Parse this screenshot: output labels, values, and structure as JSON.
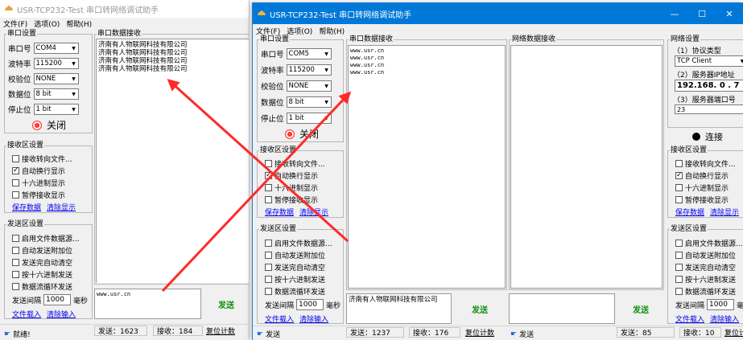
{
  "windows": [
    {
      "title": "USR-TCP232-Test 串口转网络调试助手",
      "menu": [
        "文件(F)",
        "选项(O)",
        "帮助(H)"
      ],
      "serial_settings": {
        "title": "串口设置",
        "port_label": "串口号",
        "port_value": "COM4",
        "baud_label": "波特率",
        "baud_value": "115200",
        "parity_label": "校验位",
        "parity_value": "NONE",
        "data_label": "数据位",
        "data_value": "8 bit",
        "stop_label": "停止位",
        "stop_value": "1 bit",
        "close_label": "关闭"
      },
      "recv_settings": {
        "title": "接收区设置",
        "items": [
          {
            "label": "接收转向文件...",
            "checked": false
          },
          {
            "label": "自动换行显示",
            "checked": true
          },
          {
            "label": "十六进制显示",
            "checked": false
          },
          {
            "label": "暂停接收显示",
            "checked": false
          }
        ],
        "save_label": "保存数据",
        "clear_label": "清除显示"
      },
      "send_settings": {
        "title": "发送区设置",
        "items": [
          {
            "label": "启用文件数据源...",
            "checked": false
          },
          {
            "label": "自动发送附加位",
            "checked": false
          },
          {
            "label": "发送完自动清空",
            "checked": false
          },
          {
            "label": "按十六进制发送",
            "checked": false
          },
          {
            "label": "数据流循环发送",
            "checked": false
          }
        ],
        "interval_label": "发送间隔",
        "interval_value": "1000",
        "interval_unit": "毫秒",
        "load_label": "文件载入",
        "clear_label": "清除输入"
      },
      "recv_panel": {
        "title": "串口数据接收",
        "content": "济南有人物联网科技有限公司\n济南有人物联网科技有限公司\n济南有人物联网科技有限公司\n济南有人物联网科技有限公司"
      },
      "send_input": "www.usr.cn",
      "send_button": "发送",
      "status": {
        "state": "就绪!",
        "sent": "发送：1623",
        "recv": "接收：184",
        "reset": "复位计数"
      }
    },
    {
      "title": "USR-TCP232-Test 串口转网络调试助手",
      "menu": [
        "文件(F)",
        "选项(O)",
        "帮助(H)"
      ],
      "caption": {
        "minimize": "—",
        "maximize": "☐",
        "close": "✕"
      },
      "serial_settings": {
        "title": "串口设置",
        "port_label": "串口号",
        "port_value": "COM5",
        "baud_label": "波特率",
        "baud_value": "115200",
        "parity_label": "校验位",
        "parity_value": "NONE",
        "data_label": "数据位",
        "data_value": "8 bit",
        "stop_label": "停止位",
        "stop_value": "1 bit",
        "close_label": "关闭"
      },
      "recv_settings": {
        "title": "接收区设置",
        "items": [
          {
            "label": "接收转向文件...",
            "checked": false
          },
          {
            "label": "自动换行显示",
            "checked": true
          },
          {
            "label": "十六进制显示",
            "checked": false
          },
          {
            "label": "暂停接收显示",
            "checked": false
          }
        ],
        "save_label": "保存数据",
        "clear_label": "清除显示"
      },
      "send_settings": {
        "title": "发送区设置",
        "items": [
          {
            "label": "启用文件数据源...",
            "checked": false
          },
          {
            "label": "自动发送附加位",
            "checked": false
          },
          {
            "label": "发送完自动清空",
            "checked": false
          },
          {
            "label": "按十六进制发送",
            "checked": false
          },
          {
            "label": "数据流循环发送",
            "checked": false
          }
        ],
        "interval_label": "发送间隔",
        "interval_value": "1000",
        "interval_unit": "毫秒",
        "load_label": "文件载入",
        "clear_label": "清除输入"
      },
      "recv_panel": {
        "title": "串口数据接收",
        "content": "www.usr.cn\nwww.usr.cn\nwww.usr.cn\nwww.usr.cn"
      },
      "send_input": "济南有人物联网科技有限公司",
      "send_button": "发送",
      "status": {
        "state": "发送",
        "sent": "发送：1237",
        "recv": "接收：176",
        "reset": "复位计数"
      },
      "net_panel": {
        "title": "网络数据接收",
        "send_button": "发送",
        "status": {
          "state": "发送",
          "sent": "发送：85",
          "recv": "接收：10",
          "reset": "复位计"
        }
      },
      "net_settings": {
        "title": "网络设置",
        "protocol_label": "（1）协议类型",
        "protocol_value": "TCP Client",
        "server_ip_label": "（2）服务器IP地址",
        "server_ip_value": "192.168. 0 . 7",
        "server_port_label": "（3）服务器端口号",
        "server_port_value": "23",
        "connect_label": "连接"
      },
      "net_recv_settings": {
        "title": "接收区设置",
        "items": [
          {
            "label": "接收转向文件...",
            "checked": false
          },
          {
            "label": "自动换行显示",
            "checked": true
          },
          {
            "label": "十六进制显示",
            "checked": false
          },
          {
            "label": "暂停接收显示",
            "checked": false
          }
        ],
        "save_label": "保存数据",
        "clear_label": "清除显示"
      },
      "net_send_settings": {
        "title": "发送区设置",
        "items": [
          {
            "label": "启用文件数据源...",
            "checked": false
          },
          {
            "label": "自动发送附加位",
            "checked": false
          },
          {
            "label": "发送完自动清空",
            "checked": false
          },
          {
            "label": "按十六进制发送",
            "checked": false
          },
          {
            "label": "数据流循环发送",
            "checked": false
          }
        ],
        "interval_label": "发送间隔",
        "interval_value": "1000",
        "interval_unit": "毫秒",
        "load_label": "文件载入",
        "clear_label": "清除输入"
      }
    }
  ],
  "colors": {
    "titlebar_active": "#0078d7",
    "annotation": "#ff2a2a",
    "send_text": "#0a8f0a",
    "link": "#0000ee"
  }
}
